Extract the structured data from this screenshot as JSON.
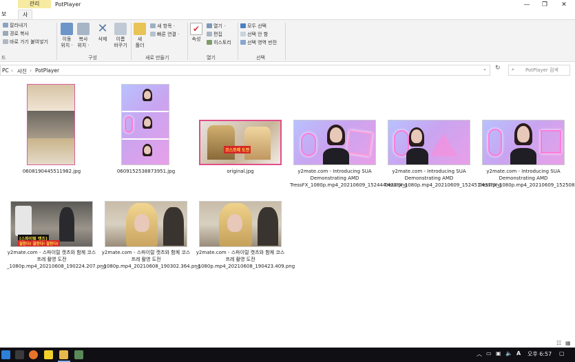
{
  "window": {
    "title": "PotPlayer",
    "context_header": "관리",
    "tabs": [
      "보기",
      "사진 도구"
    ],
    "controls": {
      "minimize": "—",
      "maximize": "❐",
      "close": "✕"
    }
  },
  "ribbon": {
    "clipboard": {
      "cut": "잘라내기",
      "copy_path": "경로 복사",
      "paste_shortcut": "바로 가기 붙여넣기",
      "group_partial": "드"
    },
    "organize": {
      "move": "이동\n위치 ·",
      "copy": "복사\n위치 ·",
      "delete": "삭제",
      "rename": "이름\n바꾸기",
      "group": "구성"
    },
    "new": {
      "new_folder": "새\n폴더",
      "new_item": "새 항목 ·",
      "easy_access": "빠른 연결 ·",
      "group": "새로 만들기"
    },
    "open": {
      "properties": "속성",
      "open": "열기 ·",
      "edit": "편집",
      "history": "히스토리",
      "group": "열기"
    },
    "select": {
      "select_all": "모두 선택",
      "select_none": "선택 안 함",
      "invert": "선택 영역 반전",
      "group": "선택"
    }
  },
  "address": {
    "crumbs": [
      "PC",
      "사진",
      "PotPlayer"
    ],
    "search_placeholder": "PotPlayer 검색"
  },
  "files": [
    {
      "name": "0608190445511982.jpg"
    },
    {
      "name": "0609152538873951.jpg"
    },
    {
      "name": "original.jpg"
    },
    {
      "name": "y2mate.com - Introducing SUA Demonstrating AMD TressFX_1080p.mp4_20210609_152444.422.png"
    },
    {
      "name": "y2mate.com - Introducing SUA Demonstrating AMD TressFX_1080p.mp4_20210609_152451.437.png"
    },
    {
      "name": "y2mate.com - Introducing SUA Demonstrating AMD TressFX_1080p.mp4_20210609_152508.293.png"
    },
    {
      "name": "y2mate.com - 스파이럴 캣츠와 함께 코스프레 촬영 도전_1080p.mp4_20210608_190224.207.png"
    },
    {
      "name": "y2mate.com - 스파이럴 캣츠와 함께 코스프레 촬영 도전_1080p.mp4_20210608_190302.364.png"
    },
    {
      "name": "y2mate.com - 스파이럴 캣츠와 함께 코스프레 촬영 도전_1080p.mp4_20210608_190423.409.png"
    }
  ],
  "thumb_text": {
    "banner1": "(스파이럴 캣츠)",
    "banner2": "잘한다! 잘한다! 잘한다!",
    "poster": "코스프레 도전"
  },
  "taskbar": {
    "clock": "오후 6:57",
    "lang": "A"
  }
}
